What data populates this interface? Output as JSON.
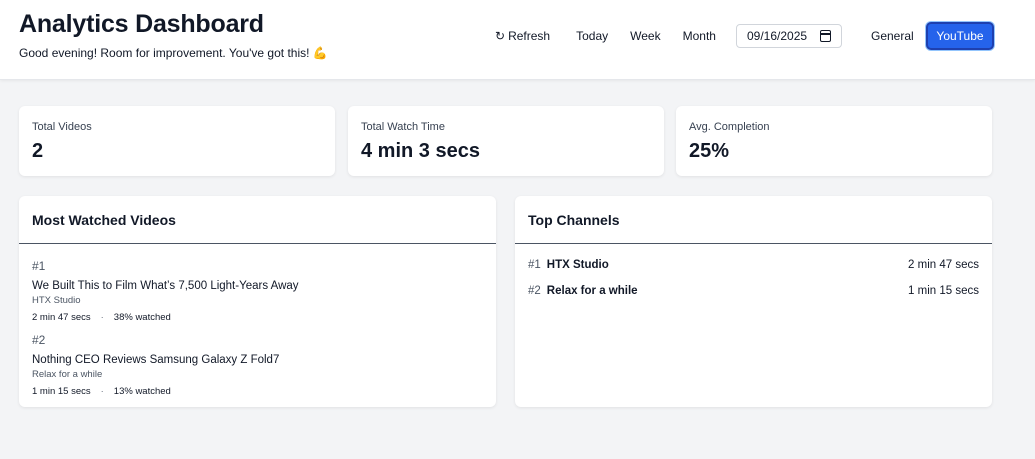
{
  "header": {
    "title": "Analytics Dashboard",
    "subtitle": "Good evening! Room for improvement. You've got this! 💪",
    "refresh_icon": "↻",
    "refresh_label": "Refresh",
    "range_today": "Today",
    "range_week": "Week",
    "range_month": "Month",
    "date_value": "09/16/2025",
    "view_general": "General",
    "view_youtube": "YouTube"
  },
  "stats": {
    "total_videos_label": "Total Videos",
    "total_videos_value": "2",
    "watch_time_label": "Total Watch Time",
    "watch_time_value": "4 min 3 secs",
    "completion_label": "Avg. Completion",
    "completion_value": "25%"
  },
  "most_watched": {
    "title": "Most Watched Videos",
    "items": [
      {
        "rank": "#1",
        "title": "We Built This to Film What’s 7,500 Light-Years Away",
        "channel": "HTX Studio",
        "duration": "2 min 47 secs",
        "separator": "·",
        "watched": "38% watched"
      },
      {
        "rank": "#2",
        "title": "Nothing CEO Reviews Samsung Galaxy Z Fold7",
        "channel": "Relax for a while",
        "duration": "1 min 15 secs",
        "separator": "·",
        "watched": "13% watched"
      }
    ]
  },
  "top_channels": {
    "title": "Top Channels",
    "items": [
      {
        "rank": "#1",
        "name": "HTX Studio",
        "time": "2 min 47 secs"
      },
      {
        "rank": "#2",
        "name": "Relax for a while",
        "time": "1 min 15 secs"
      }
    ]
  },
  "colors": {
    "accent": "#2563eb",
    "background": "#f3f4f6",
    "card": "#ffffff"
  }
}
